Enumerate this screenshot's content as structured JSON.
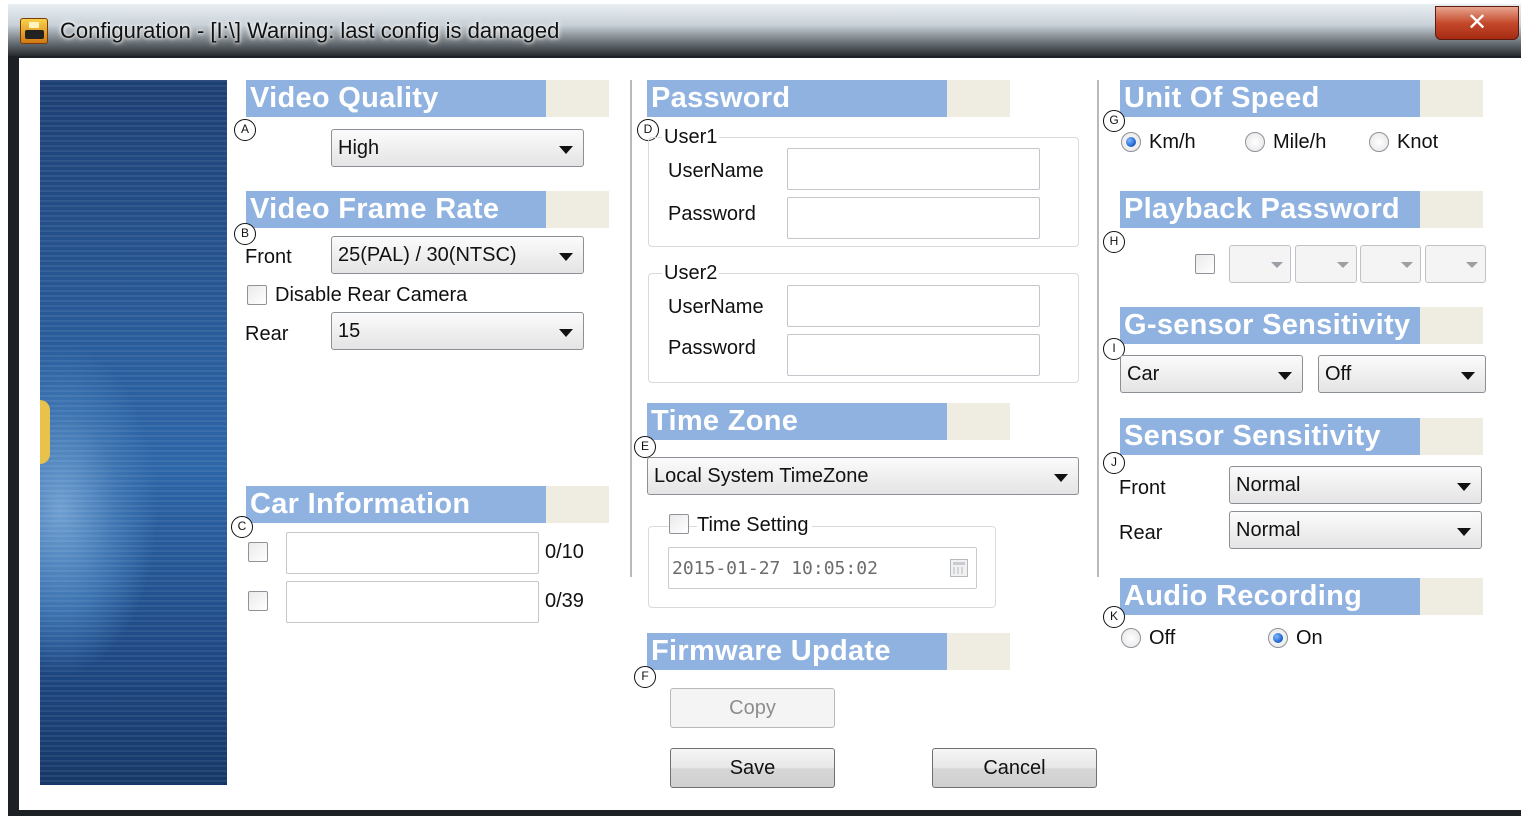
{
  "window": {
    "title": "Configuration - [I:\\] Warning: last config is damaged",
    "close_label": "✕"
  },
  "markers": {
    "a": "A",
    "b": "B",
    "c": "C",
    "d": "D",
    "e": "E",
    "f": "F",
    "g": "G",
    "h": "H",
    "i": "I",
    "j": "J",
    "k": "K"
  },
  "video_quality": {
    "header": "Video Quality",
    "value": "High"
  },
  "video_frame_rate": {
    "header": "Video Frame Rate",
    "front_label": "Front",
    "front_value": "25(PAL) / 30(NTSC)",
    "disable_rear_label": "Disable Rear Camera",
    "rear_label": "Rear",
    "rear_value": "15"
  },
  "car_information": {
    "header": "Car Information",
    "field1_count": "0/10",
    "field2_count": "0/39"
  },
  "password": {
    "header": "Password",
    "user1": {
      "title": "User1",
      "username_label": "UserName",
      "password_label": "Password"
    },
    "user2": {
      "title": "User2",
      "username_label": "UserName",
      "password_label": "Password"
    }
  },
  "time_zone": {
    "header": "Time Zone",
    "value": "Local System TimeZone",
    "time_setting_label": "Time Setting",
    "time_value": "2015-01-27 10:05:02"
  },
  "firmware_update": {
    "header": "Firmware Update",
    "copy_label": "Copy"
  },
  "actions": {
    "save_label": "Save",
    "cancel_label": "Cancel"
  },
  "unit_of_speed": {
    "header": "Unit Of Speed",
    "options": [
      "Km/h",
      "Mile/h",
      "Knot"
    ],
    "selected": "Km/h"
  },
  "playback_password": {
    "header": "Playback Password"
  },
  "g_sensor": {
    "header": "G-sensor Sensitivity",
    "vehicle_value": "Car",
    "level_value": "Off"
  },
  "sensor_sensitivity": {
    "header": "Sensor Sensitivity",
    "front_label": "Front",
    "front_value": "Normal",
    "rear_label": "Rear",
    "rear_value": "Normal"
  },
  "audio_recording": {
    "header": "Audio Recording",
    "off_label": "Off",
    "on_label": "On",
    "selected": "On"
  },
  "colors": {
    "header_blue": "#8fb2e0",
    "header_tail": "#efece2",
    "radio_selected": "#1a5fc8"
  }
}
